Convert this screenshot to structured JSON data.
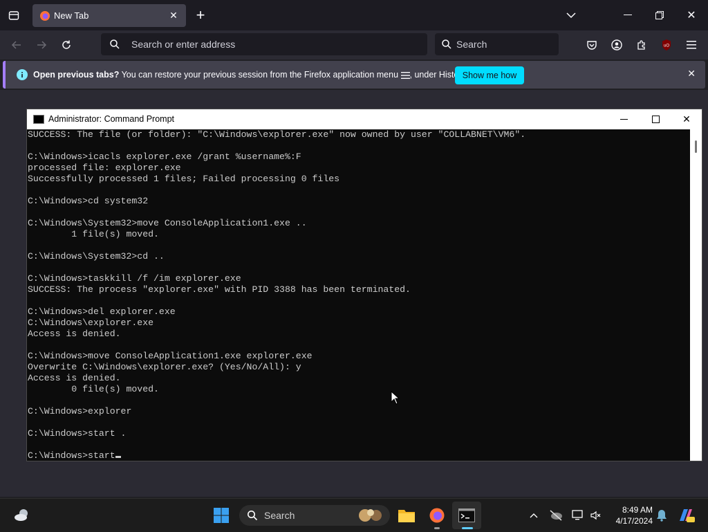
{
  "browser": {
    "tab_title": "New Tab",
    "url_placeholder": "Search or enter address",
    "search_placeholder": "Search",
    "notice": {
      "bold": "Open previous tabs?",
      "text": " You can restore your previous session from the Firefox application menu ",
      "text_after": ", under History.",
      "button": "Show me how"
    },
    "ublock_badge": "uO"
  },
  "cmd": {
    "title": "Administrator: Command Prompt",
    "lines": [
      "SUCCESS: The file (or folder): \"C:\\Windows\\explorer.exe\" now owned by user \"COLLABNET\\VM6\".",
      "",
      "C:\\Windows>icacls explorer.exe /grant %username%:F",
      "processed file: explorer.exe",
      "Successfully processed 1 files; Failed processing 0 files",
      "",
      "C:\\Windows>cd system32",
      "",
      "C:\\Windows\\System32>move ConsoleApplication1.exe ..",
      "        1 file(s) moved.",
      "",
      "C:\\Windows\\System32>cd ..",
      "",
      "C:\\Windows>taskkill /f /im explorer.exe",
      "SUCCESS: The process \"explorer.exe\" with PID 3388 has been terminated.",
      "",
      "C:\\Windows>del explorer.exe",
      "C:\\Windows\\explorer.exe",
      "Access is denied.",
      "",
      "C:\\Windows>move ConsoleApplication1.exe explorer.exe",
      "Overwrite C:\\Windows\\explorer.exe? (Yes/No/All): y",
      "Access is denied.",
      "        0 file(s) moved.",
      "",
      "C:\\Windows>explorer",
      "",
      "C:\\Windows>start .",
      ""
    ],
    "prompt_line": "C:\\Windows>start"
  },
  "taskbar": {
    "search_placeholder": "Search",
    "time": "8:49 AM",
    "date": "4/17/2024"
  },
  "colors": {
    "firefox_bg": "#1c1b22",
    "accent_cyan": "#00ddff",
    "console_text": "#cccccc"
  }
}
